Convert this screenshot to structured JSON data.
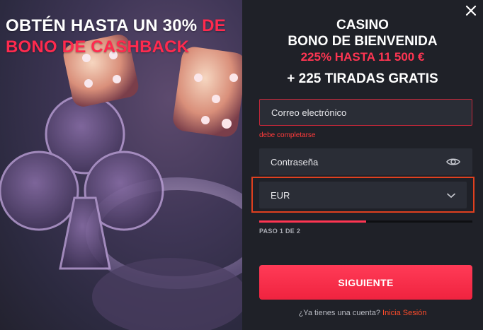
{
  "promo": {
    "line1": "OBTÉN HASTA UN 30%",
    "line1_red": "DE",
    "line2_red": "BONO DE CASHBACK"
  },
  "headline": {
    "line1": "CASINO",
    "line2": "BONO DE BIENVENIDA",
    "line3": "225% HASTA 11 500 €",
    "line4": "+ 225 TIRADAS GRATIS"
  },
  "form": {
    "email_placeholder": "Correo electrónico",
    "email_error": "debe completarse",
    "password_placeholder": "Contraseña",
    "currency_value": "EUR",
    "progress_fraction": 0.5,
    "step_label": "PASO 1 DE 2",
    "next_label": "SIGUIENTE",
    "login_prompt": "¿Ya tienes una cuenta?",
    "login_link": "Inicia Sesión"
  },
  "icons": {
    "close": "close-icon",
    "eye": "eye-icon",
    "chevron": "chevron-down-icon"
  },
  "colors": {
    "accent": "#ff3552",
    "error": "#ff3b3b",
    "highlight_border": "#e0401f",
    "panel_bg": "#1f2128",
    "field_bg": "#2a2d36"
  }
}
